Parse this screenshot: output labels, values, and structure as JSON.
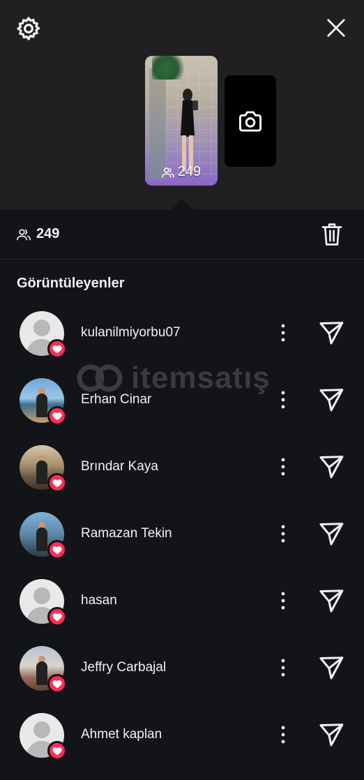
{
  "header": {
    "settings_icon": "gear-icon",
    "close_icon": "close-icon"
  },
  "story": {
    "views_on_thumbnail": "249",
    "camera_icon": "camera-icon"
  },
  "stats": {
    "viewer_count": "249",
    "viewers_icon": "people-icon",
    "delete_icon": "trash-icon"
  },
  "section": {
    "title": "Görüntüleyenler"
  },
  "viewers": [
    {
      "username": "kulanilmiyorbu07",
      "avatar": "default",
      "liked": true
    },
    {
      "username": "Erhan Cinar",
      "avatar": "photo",
      "liked": true
    },
    {
      "username": "Brındar Kaya",
      "avatar": "photo",
      "liked": true
    },
    {
      "username": "Ramazan Tekin",
      "avatar": "photo",
      "liked": true
    },
    {
      "username": "hasan",
      "avatar": "default",
      "liked": true
    },
    {
      "username": "Jeffry Carbajal",
      "avatar": "photo",
      "liked": true
    },
    {
      "username": "Ahmet kaplan",
      "avatar": "default",
      "liked": true
    }
  ],
  "watermark": {
    "text": "itemsatış"
  },
  "colors": {
    "background": "#121418",
    "header_bg": "#202022",
    "heart": "#ff2d55"
  }
}
